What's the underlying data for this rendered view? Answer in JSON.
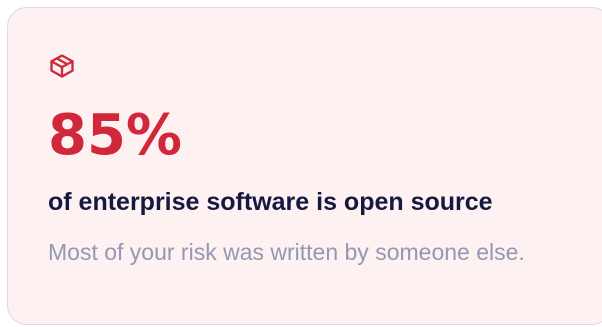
{
  "card": {
    "icon": "package-icon",
    "accent_color": "#d0283a",
    "background_color": "#fdf1f2",
    "stat": "85%",
    "headline": "of enterprise software is open source",
    "description": "Most of your risk was written by someone else."
  }
}
